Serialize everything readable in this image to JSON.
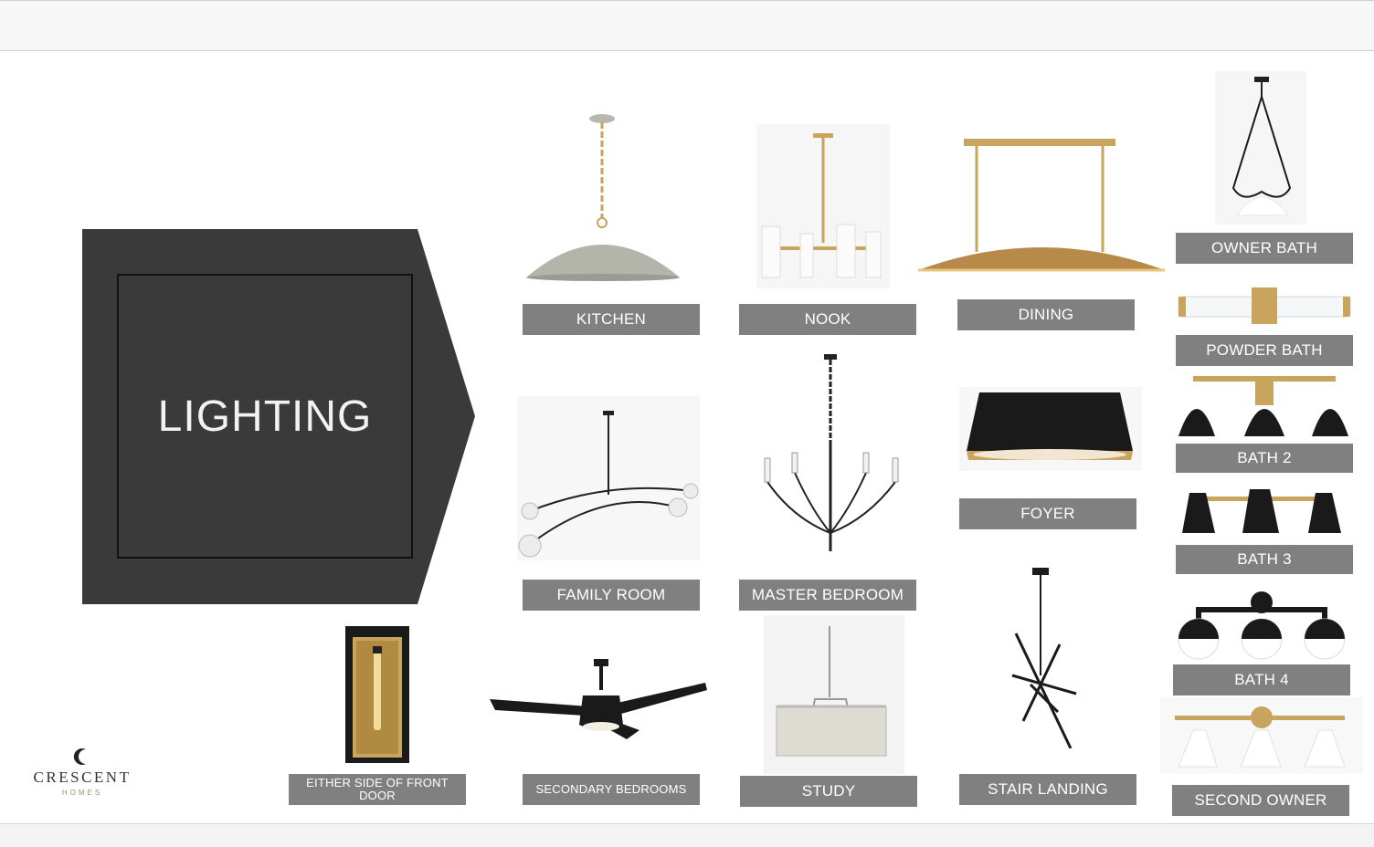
{
  "slide": {
    "title": "LIGHTING",
    "logo": {
      "name": "CRESCENT",
      "sub": "HOMES",
      "icon": "crescent-moon-icon"
    }
  },
  "fixtures": {
    "kitchen": "KITCHEN",
    "nook": "NOOK",
    "dining": "DINING",
    "owner_bath": "OWNER BATH",
    "powder_bath": "POWDER BATH",
    "family_room": "FAMILY ROOM",
    "master_bedroom": "MASTER BEDROOM",
    "foyer": "FOYER",
    "bath2": "BATH 2",
    "bath3": "BATH 3",
    "bath4": "BATH 4",
    "front_door": "EITHER SIDE OF FRONT DOOR",
    "secondary_bedrooms": "SECONDARY BEDROOMS",
    "study": "STUDY",
    "stair_landing": "STAIR LANDING",
    "second_owner": "SECOND OWNER"
  },
  "colors": {
    "label_bg": "#808080",
    "title_panel": "#3a3a3a",
    "brass": "#c9a45c",
    "black_fixture": "#1a1a1a"
  }
}
